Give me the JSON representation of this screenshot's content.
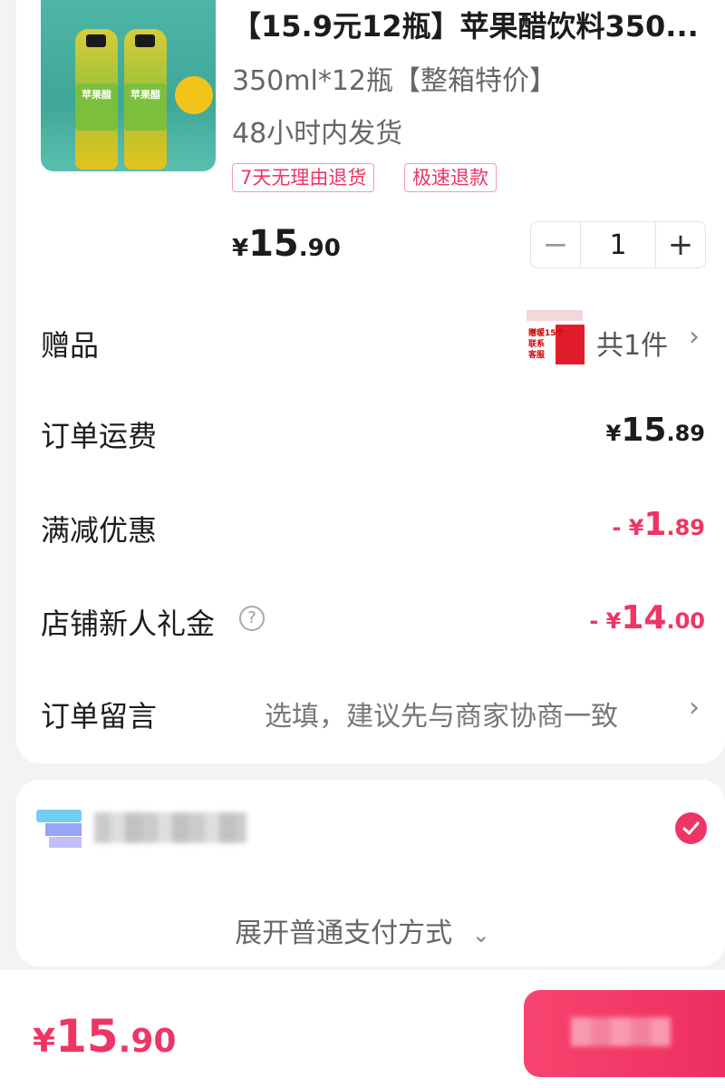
{
  "product": {
    "title": "【15.9元12瓶】苹果醋饮料350...",
    "spec": "350ml*12瓶【整箱特价】",
    "shipping": "48小时内发货",
    "tags": [
      "7天无理由退货",
      "极速退款"
    ],
    "image_label": "苹果醋",
    "price": {
      "currency": "¥",
      "integer": "15",
      "decimal": ".90"
    },
    "quantity": "1",
    "minus": "−",
    "plus": "+"
  },
  "rows": {
    "gift": {
      "label": "赠品",
      "count": "共1件",
      "image_text": [
        "赠暖15个",
        "联系",
        "客服",
        "贴 财"
      ]
    },
    "shipping_fee": {
      "label": "订单运费",
      "currency": "¥",
      "integer": "15",
      "decimal": ".89"
    },
    "discount": {
      "label": "满减优惠",
      "currency": "- ¥",
      "integer": "1",
      "decimal": ".89"
    },
    "new_customer": {
      "label": "店铺新人礼金",
      "currency": "- ¥",
      "integer": "14",
      "decimal": ".00",
      "help_icon": "?"
    },
    "note": {
      "label": "订单留言",
      "placeholder": "选填，建议先与商家协商一致"
    }
  },
  "payment": {
    "selected": true,
    "expand_label": "展开普通支付方式"
  },
  "footer": {
    "total": {
      "currency": "¥",
      "integer": "15",
      "decimal": ".90"
    }
  },
  "colors": {
    "accent": "#ee3565"
  }
}
